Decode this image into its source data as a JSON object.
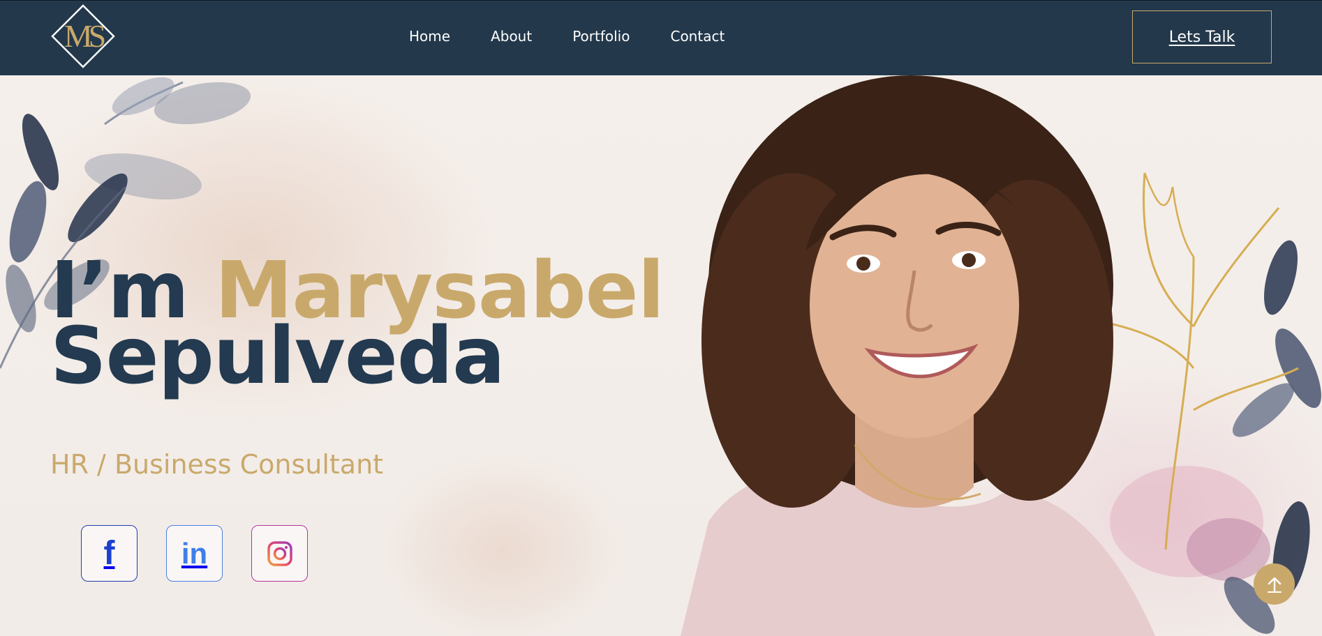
{
  "header": {
    "logo_text": "MS",
    "nav": [
      {
        "label": "Home"
      },
      {
        "label": "About"
      },
      {
        "label": "Portfolio"
      },
      {
        "label": "Contact"
      }
    ],
    "cta_label": "Lets Talk"
  },
  "hero": {
    "title_prefix": "I’m ",
    "title_first_name": "Marysabel",
    "title_last_name": "Sepulveda",
    "subtitle": "HR / Business Consultant",
    "socials": [
      {
        "name": "facebook",
        "glyph": "f"
      },
      {
        "name": "linkedin",
        "glyph": "in"
      },
      {
        "name": "instagram"
      }
    ]
  },
  "colors": {
    "navy": "#23384b",
    "gold": "#c9a96b",
    "title_dark": "#233a50",
    "facebook_blue": "#1c3fd0",
    "linkedin_blue": "#3f7ee8",
    "instagram_magenta": "#b6349c"
  },
  "icons": {
    "scroll_top": "arrow-up-icon"
  }
}
